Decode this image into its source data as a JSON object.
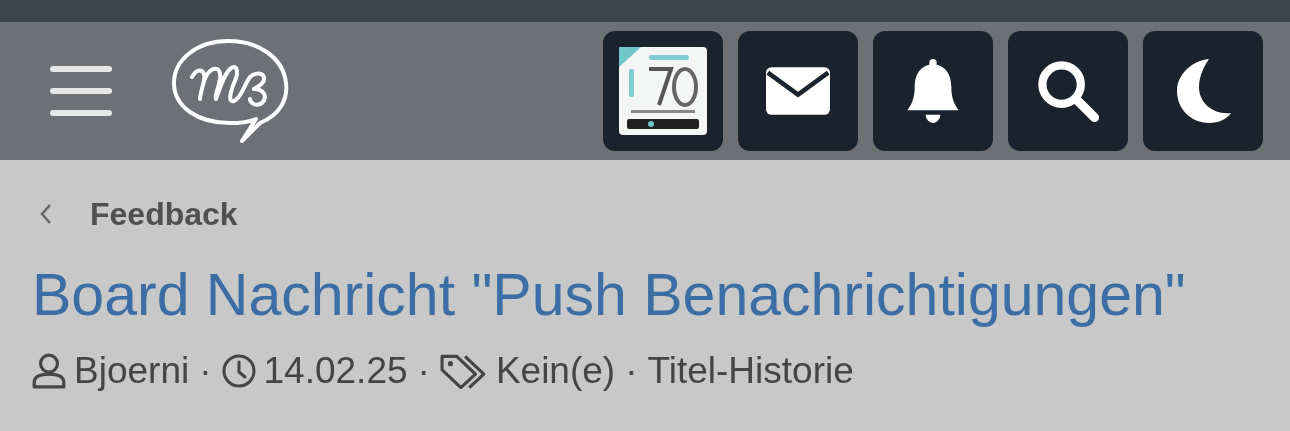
{
  "header": {
    "buttons": [
      {
        "kind": "picture"
      },
      {
        "kind": "mail"
      },
      {
        "kind": "bell"
      },
      {
        "kind": "search"
      },
      {
        "kind": "moon"
      }
    ]
  },
  "breadcrumb": {
    "label": "Feedback"
  },
  "title": "Board Nachricht \"Push Benachrichtigungen\"",
  "meta": [
    {
      "kind": "user",
      "text": "Bjoerni"
    },
    {
      "kind": "separator",
      "text": "·"
    },
    {
      "kind": "clock",
      "text": "14.02.25"
    },
    {
      "kind": "separator",
      "text": "·"
    },
    {
      "kind": "tags",
      "text": "Kein(e)"
    },
    {
      "kind": "separator",
      "text": "·"
    },
    {
      "kind": "link",
      "text": "Titel-Historie"
    }
  ]
}
